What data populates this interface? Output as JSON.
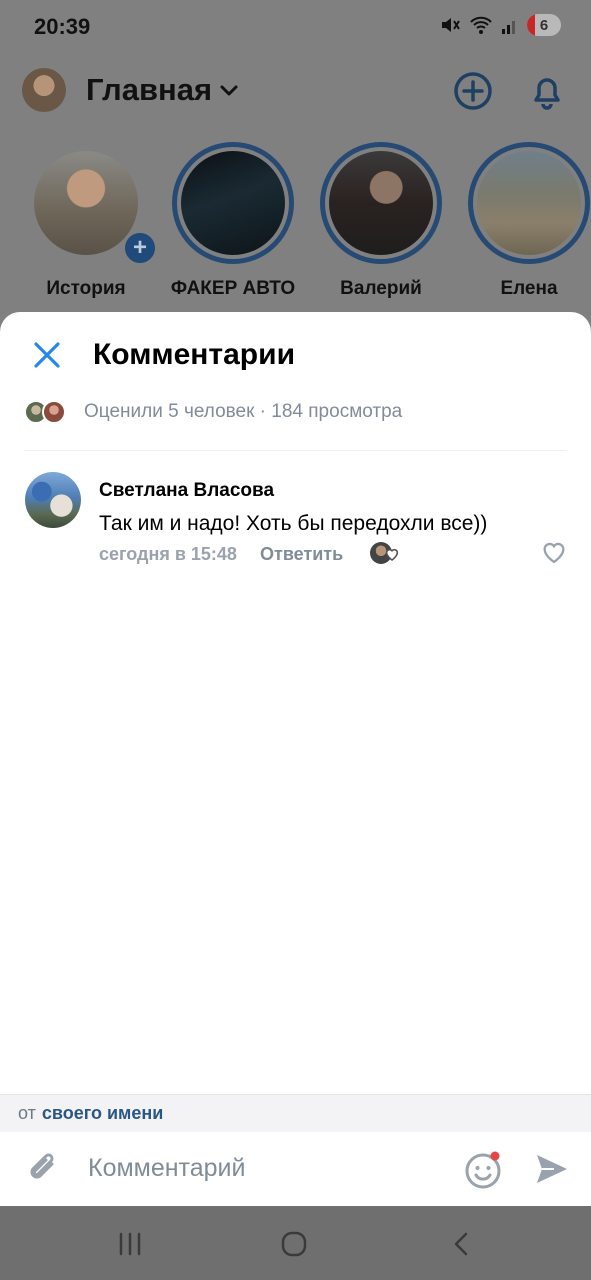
{
  "status": {
    "time": "20:39",
    "battery": "6"
  },
  "header": {
    "title": "Главная"
  },
  "stories": [
    {
      "label": "История",
      "has_add": true
    },
    {
      "label": "ФАКЕР АВТО"
    },
    {
      "label": "Валерий"
    },
    {
      "label": "Елена"
    }
  ],
  "sheet": {
    "title": "Комментарии",
    "likes_text": "Оценили 5 человек · 184 просмотра"
  },
  "comment": {
    "author": "Светлана Власова",
    "text": "Так им и надо!  Хоть бы передохли все))",
    "time": "сегодня в 15:48",
    "reply_label": "Ответить"
  },
  "author_bar": {
    "prefix": "от",
    "link": "своего имени"
  },
  "input": {
    "placeholder": "Комментарий"
  },
  "colors": {
    "accent": "#2688eb",
    "link": "#2a5885",
    "secondary_text": "#818c99",
    "badge": "#e64646"
  },
  "icons": [
    "close-icon",
    "attach-icon",
    "emoji-icon",
    "send-icon",
    "heart-icon",
    "plus-circle-icon",
    "bell-icon",
    "chevron-down-icon"
  ]
}
